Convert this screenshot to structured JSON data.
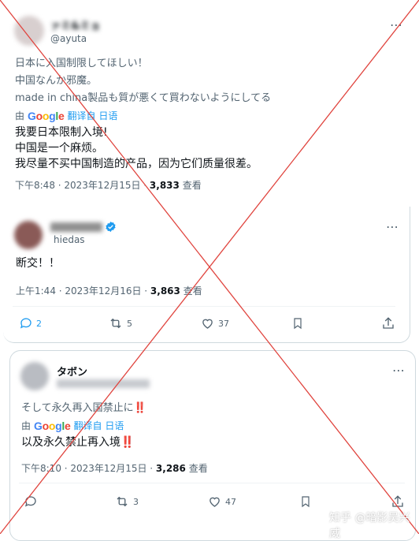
{
  "tweet1": {
    "name": "ァミ&ミョ",
    "handle": "@ayuta",
    "jp_lines": [
      "日本に入国制限してほしい！",
      "中国なんか邪魔。",
      "made in china製品も質が悪くて買わないようにしてる"
    ],
    "translate_by": "由",
    "translate_brand": "Google",
    "translate_link": "翻译自 日语",
    "zh_lines": [
      "我要日本限制入境!",
      "中国是一个麻烦。",
      "我尽量不买中国制造的产品，因为它们质量很差。"
    ],
    "time": "下午8:48 · 2023年12月15日 · ",
    "views": "3,833",
    "views_label": " 查看"
  },
  "tweet2": {
    "name": "",
    "handle": "hiedas",
    "text": "断交！！",
    "time": "上午1:44 · 2023年12月16日 · ",
    "views": "3,863",
    "views_label": " 查看",
    "actions": {
      "replies": "2",
      "retweets": "5",
      "likes": "37"
    }
  },
  "tweet3": {
    "name": "タボン",
    "handle": "",
    "jp_line": "そして永久再入国禁止に‼️",
    "translate_by": "由",
    "translate_brand": "Google",
    "translate_link": "翻译自 日语",
    "zh_line": "以及永久禁止再入境‼️",
    "time": "下午8:10 · 2023年12月15日 · ",
    "views": "3,286",
    "views_label": " 查看",
    "actions": {
      "retweets": "3",
      "likes": "47"
    }
  },
  "watermark": "知乎 @暗影吴兴威",
  "colors": {
    "accent": "#1d9bf0",
    "red_x": "#e0443e",
    "muted": "#536471",
    "border": "#cfd9de"
  }
}
